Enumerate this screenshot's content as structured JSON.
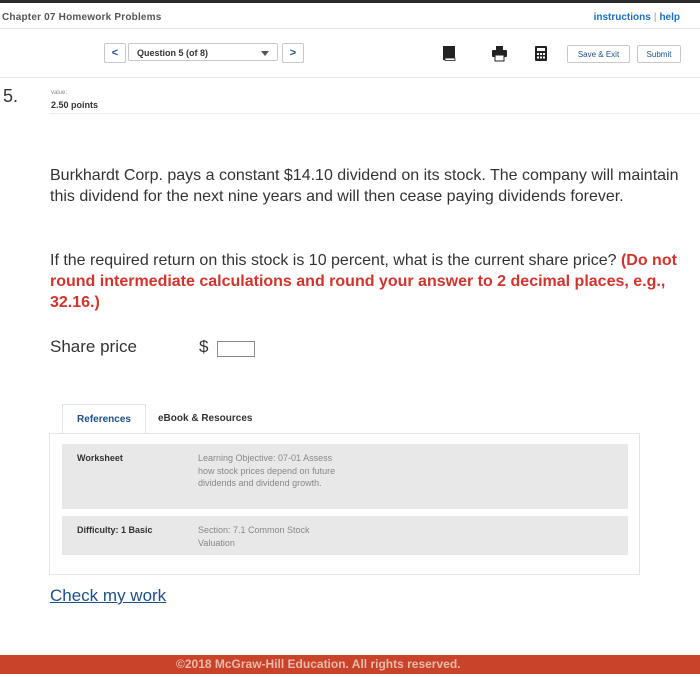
{
  "header": {
    "chapter_title": "Chapter 07 Homework Problems",
    "links": {
      "instructions": "instructions",
      "help": "help"
    }
  },
  "nav": {
    "prev_label": "<",
    "next_label": ">",
    "question_select": "Question 5 (of 8)",
    "icons": [
      "book-icon",
      "print-icon",
      "calculator-icon"
    ],
    "save_exit_label": "Save & Exit",
    "submit_label": "Submit"
  },
  "question": {
    "number": "5.",
    "value_label": "value:",
    "points": "2.50 points",
    "paragraph1": "Burkhardt Corp. pays a constant $14.10 dividend on its stock. The company will maintain this dividend for the next nine years and will then cease paying dividends forever.",
    "paragraph2_plain": "If the required return on this stock is 10 percent, what is the current share price? ",
    "paragraph2_red": "(Do not round intermediate calculations and round your answer to 2 decimal places, e.g., 32.16.)",
    "answer_label": "Share price",
    "currency_symbol": "$",
    "answer_value": ""
  },
  "resources": {
    "tabs": [
      "References",
      "eBook & Resources"
    ],
    "rows": [
      {
        "label": "Worksheet",
        "description": "Learning Objective: 07-01 Assess how stock prices depend on future dividends and dividend growth."
      },
      {
        "label": "Difficulty: 1 Basic",
        "description": "Section: 7.1 Common Stock Valuation"
      }
    ]
  },
  "check_my_work": "Check my work",
  "footer": "©2018 McGraw-Hill Education. All rights reserved.",
  "colors": {
    "accent": "#1d4f86",
    "emphasis": "#d0342c",
    "footer": "#c9432b"
  }
}
